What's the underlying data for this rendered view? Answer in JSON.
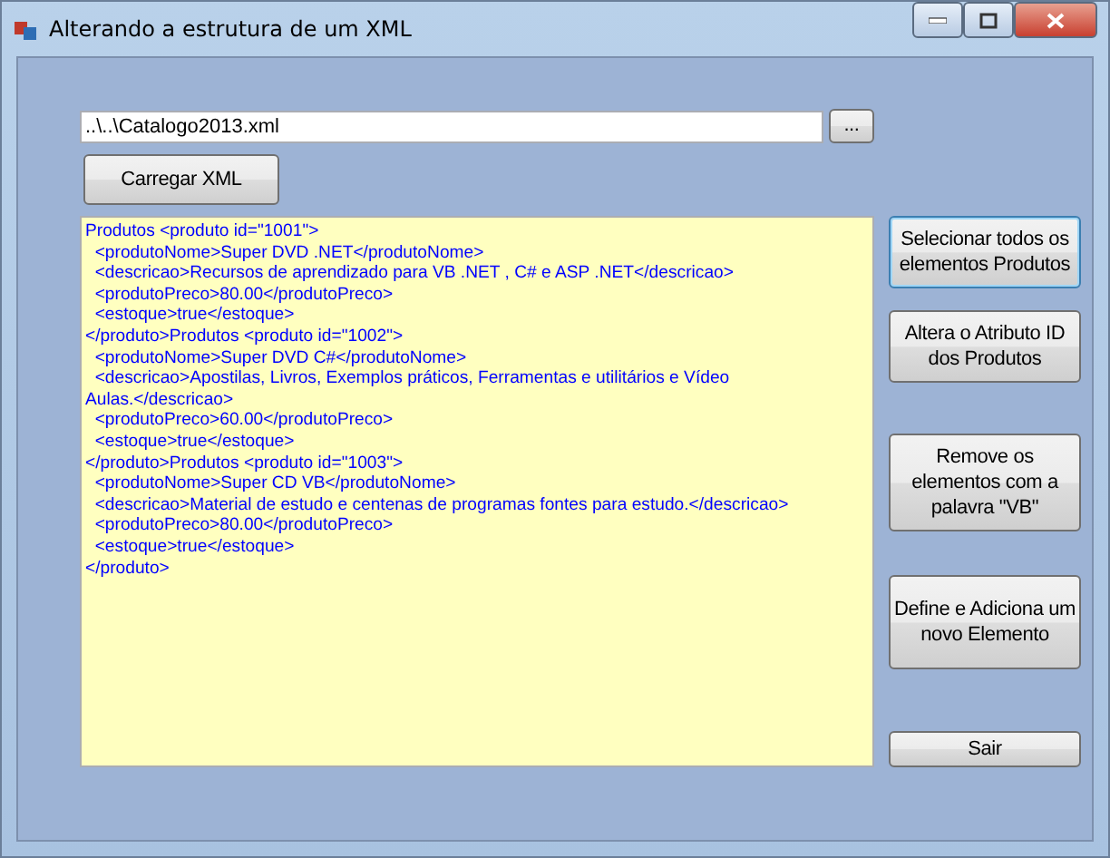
{
  "window": {
    "title": "Alterando a estrutura de um XML"
  },
  "file_path": {
    "value": "..\\..\\Catalogo2013.xml"
  },
  "browse_button": {
    "label": "..."
  },
  "load_button": {
    "label": "Carregar XML"
  },
  "xml_text": {
    "lines": [
      "Produtos <produto id=\"1001\">",
      "  <produtoNome>Super DVD .NET</produtoNome>",
      "  <descricao>Recursos de aprendizado para VB .NET , C# e ASP .NET</descricao>",
      "  <produtoPreco>80.00</produtoPreco>",
      "  <estoque>true</estoque>",
      "</produto>Produtos <produto id=\"1002\">",
      "  <produtoNome>Super DVD C#</produtoNome>",
      "  <descricao>Apostilas, Livros, Exemplos práticos, Ferramentas e utilitários e Vídeo",
      "Aulas.</descricao>",
      "  <produtoPreco>60.00</produtoPreco>",
      "  <estoque>true</estoque>",
      "</produto>Produtos <produto id=\"1003\">",
      "  <produtoNome>Super CD VB</produtoNome>",
      "  <descricao>Material de estudo e centenas de programas fontes para estudo.</descricao>",
      "  <produtoPreco>80.00</produtoPreco>",
      "  <estoque>true</estoque>",
      "</produto>"
    ]
  },
  "actions": [
    {
      "label": "Selecionar todos os elementos Produtos",
      "focused": true
    },
    {
      "label": "Altera o Atributo ID dos Produtos",
      "focused": false
    },
    {
      "label": "Remove os elementos com a palavra  \"VB\"",
      "focused": false
    },
    {
      "label": "Define e Adiciona um novo Elemento",
      "focused": false
    },
    {
      "label": "Sair",
      "focused": false
    }
  ]
}
